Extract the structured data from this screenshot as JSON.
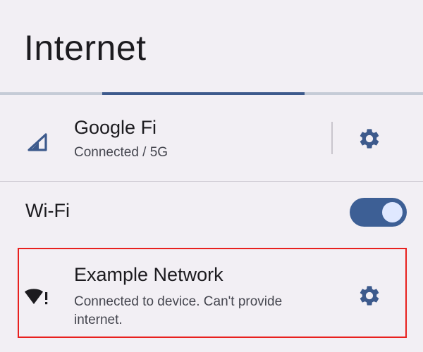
{
  "page": {
    "title": "Internet"
  },
  "mobile_network": {
    "name": "Google Fi",
    "status": "Connected / 5G",
    "icon": "cellular-signal-icon",
    "settings_icon": "gear-icon"
  },
  "wifi": {
    "label": "Wi-Fi",
    "toggle_on": true
  },
  "networks": [
    {
      "name": "Example Network",
      "status": "Connected to device. Can't provide internet.",
      "icon": "wifi-warning-icon",
      "settings_icon": "gear-icon",
      "highlighted": true
    }
  ],
  "colors": {
    "background": "#f2eff4",
    "accent": "#3d5f95",
    "highlight_border": "#e8201e"
  }
}
